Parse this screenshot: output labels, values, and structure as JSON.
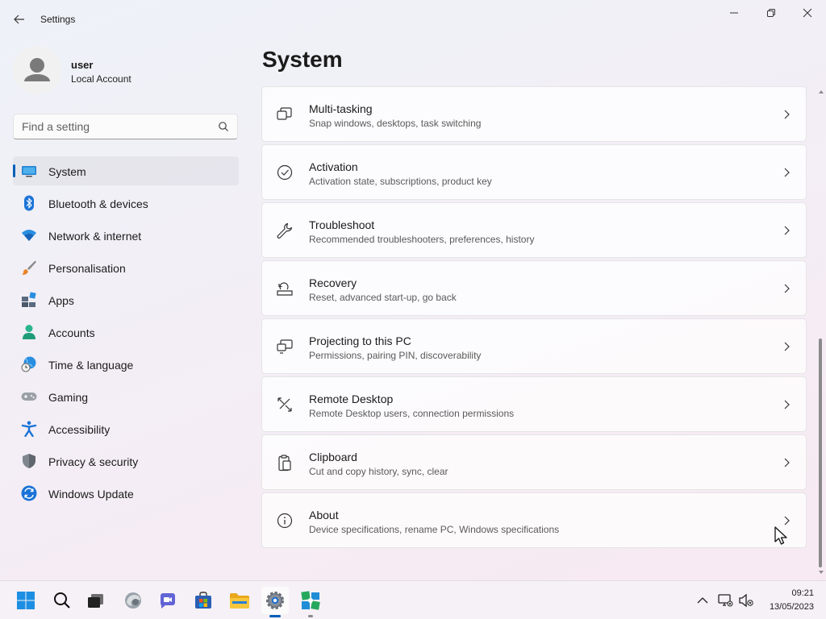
{
  "window": {
    "title": "Settings",
    "controls": [
      "minimize-icon",
      "maximize-icon",
      "close-icon"
    ]
  },
  "user": {
    "name": "user",
    "account_type": "Local Account"
  },
  "search": {
    "placeholder": "Find a setting"
  },
  "sidebar": {
    "items": [
      {
        "label": "System",
        "icon": "system-icon",
        "selected": true
      },
      {
        "label": "Bluetooth & devices",
        "icon": "bluetooth-icon"
      },
      {
        "label": "Network & internet",
        "icon": "wifi-icon"
      },
      {
        "label": "Personalisation",
        "icon": "brush-icon"
      },
      {
        "label": "Apps",
        "icon": "apps-icon"
      },
      {
        "label": "Accounts",
        "icon": "accounts-icon"
      },
      {
        "label": "Time & language",
        "icon": "globe-clock-icon"
      },
      {
        "label": "Gaming",
        "icon": "gamepad-icon"
      },
      {
        "label": "Accessibility",
        "icon": "accessibility-icon"
      },
      {
        "label": "Privacy & security",
        "icon": "shield-icon"
      },
      {
        "label": "Windows Update",
        "icon": "update-icon"
      }
    ]
  },
  "main": {
    "title": "System",
    "cards": [
      {
        "title": "Multi-tasking",
        "description": "Snap windows, desktops, task switching",
        "icon": "multitasking-icon"
      },
      {
        "title": "Activation",
        "description": "Activation state, subscriptions, product key",
        "icon": "activation-check-icon"
      },
      {
        "title": "Troubleshoot",
        "description": "Recommended troubleshooters, preferences, history",
        "icon": "wrench-icon"
      },
      {
        "title": "Recovery",
        "description": "Reset, advanced start-up, go back",
        "icon": "recovery-icon"
      },
      {
        "title": "Projecting to this PC",
        "description": "Permissions, pairing PIN, discoverability",
        "icon": "projecting-icon"
      },
      {
        "title": "Remote Desktop",
        "description": "Remote Desktop users, connection permissions",
        "icon": "remote-desktop-icon"
      },
      {
        "title": "Clipboard",
        "description": "Cut and copy history, sync, clear",
        "icon": "clipboard-icon"
      },
      {
        "title": "About",
        "description": "Device specifications, rename PC, Windows specifications",
        "icon": "info-icon"
      }
    ]
  },
  "taskbar": {
    "apps": [
      "start-icon",
      "search-icon",
      "task-view-icon",
      "edge-icon",
      "teams-chat-icon",
      "store-icon",
      "file-explorer-icon",
      "settings-gear-icon",
      "app-icon"
    ],
    "clock": {
      "time": "09:21",
      "date": "13/05/2023"
    }
  },
  "colors": {
    "accent": "#005fb8"
  }
}
